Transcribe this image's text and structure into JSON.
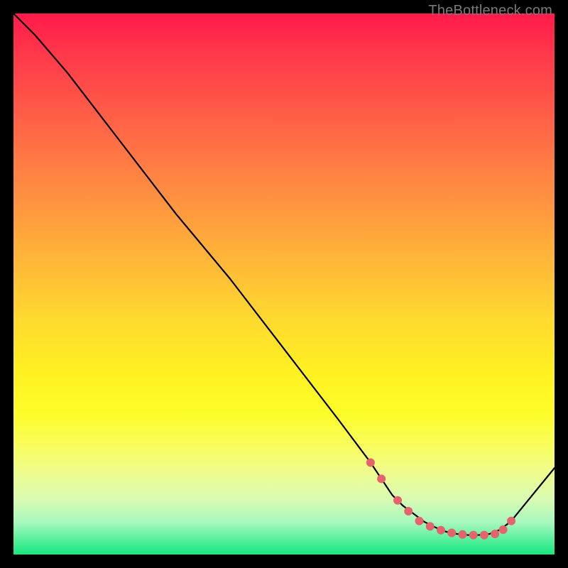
{
  "watermark": "TheBottleneck.com",
  "chart_data": {
    "type": "line",
    "title": "",
    "xlabel": "",
    "ylabel": "",
    "xlim": [
      0,
      100
    ],
    "ylim": [
      0,
      100
    ],
    "grid": false,
    "series": [
      {
        "name": "curve",
        "color": "#000000",
        "x": [
          0,
          4,
          10,
          20,
          30,
          40,
          50,
          60,
          66,
          70,
          72,
          74,
          76,
          78,
          80,
          82,
          84,
          86,
          88,
          90,
          92,
          100
        ],
        "y": [
          100,
          96,
          89,
          76,
          63,
          51,
          38,
          25,
          17,
          11,
          9,
          7.5,
          6,
          5,
          4.2,
          3.8,
          3.6,
          3.6,
          3.8,
          4.6,
          6.2,
          16
        ]
      },
      {
        "name": "markers",
        "color": "#e4636c",
        "x": [
          66,
          68,
          71,
          73,
          75,
          77,
          79,
          81,
          83,
          85,
          87,
          89,
          90.5,
          92
        ],
        "y": [
          17,
          14,
          10,
          8,
          6.2,
          5.2,
          4.5,
          4.0,
          3.7,
          3.6,
          3.6,
          3.8,
          4.6,
          6.2
        ]
      }
    ]
  }
}
